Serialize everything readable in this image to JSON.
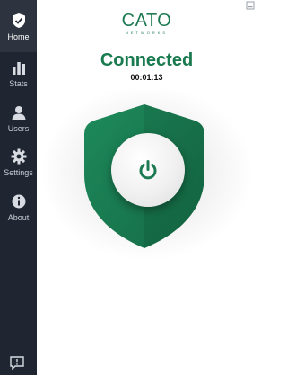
{
  "sidebar": {
    "items": [
      {
        "label": "Home",
        "icon": "shield-check-icon",
        "active": true
      },
      {
        "label": "Stats",
        "icon": "bar-chart-icon",
        "active": false
      },
      {
        "label": "Users",
        "icon": "user-icon",
        "active": false
      },
      {
        "label": "Settings",
        "icon": "gear-icon",
        "active": false
      },
      {
        "label": "About",
        "icon": "info-icon",
        "active": false
      }
    ],
    "feedback_icon": "feedback-icon"
  },
  "header": {
    "logo_text": "CATO",
    "logo_subtext": "NETWORKS"
  },
  "connection": {
    "status": "Connected",
    "elapsed": "00:01:13"
  },
  "colors": {
    "accent": "#1d7a52",
    "sidebar_bg": "#1f2631",
    "shield": "#1c7f55"
  }
}
